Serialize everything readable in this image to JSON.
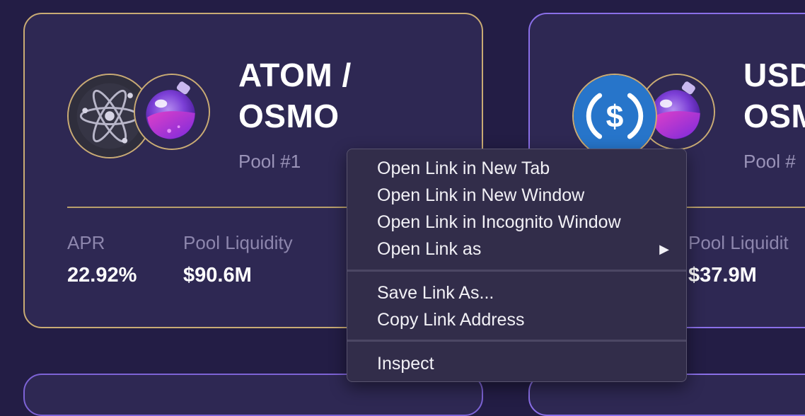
{
  "pools": [
    {
      "title_line1": "ATOM /",
      "title_line2": "OSMO",
      "pool_id": "Pool #1",
      "apr_label": "APR",
      "apr_value": "22.92%",
      "liquidity_label": "Pool Liquidity",
      "liquidity_value": "$90.6M",
      "token_a_icon": "cosmos-atom-icon",
      "token_b_icon": "osmosis-icon"
    },
    {
      "title_line1": "USD",
      "title_line2": "OSM",
      "pool_id": "Pool #",
      "liquidity_label": "Pool Liquidit",
      "liquidity_value": "$37.9M",
      "token_a_icon": "usdc-icon",
      "token_b_icon": "osmosis-icon"
    }
  ],
  "context_menu": {
    "items": [
      {
        "label": "Open Link in New Tab"
      },
      {
        "label": "Open Link in New Window"
      },
      {
        "label": "Open Link in Incognito Window"
      },
      {
        "label": "Open Link as",
        "submenu_icon": "submenu-arrow-icon"
      },
      {
        "label": "Save Link As..."
      },
      {
        "label": "Copy Link Address"
      },
      {
        "label": "Inspect"
      }
    ]
  },
  "colors": {
    "background": "#231d45",
    "card": "#2e2853",
    "card_border_gold": "#c9ab74",
    "card_border_purple": "#8a6fe8",
    "menu": "#322d4a"
  }
}
